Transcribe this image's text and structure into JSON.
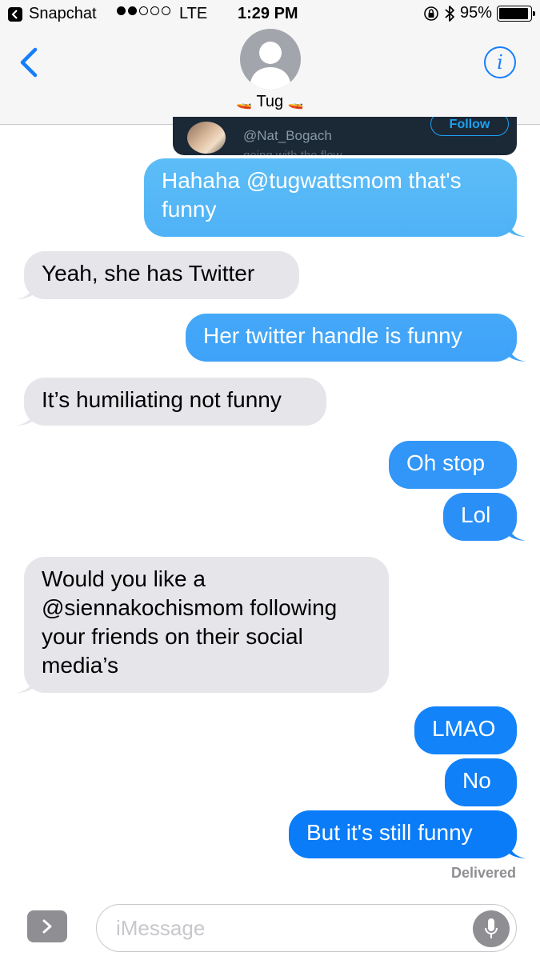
{
  "status_bar": {
    "app_back_label": "Snapchat",
    "signal_full_dots": 2,
    "signal_total_dots": 5,
    "carrier": "LTE",
    "time": "1:29 PM",
    "battery_percent": "95%",
    "battery_level": 0.95,
    "icons": [
      "orientation-lock-icon",
      "bluetooth-icon",
      "battery-icon"
    ]
  },
  "header": {
    "back_icon": "chevron-left-icon",
    "contact_name": "Tug",
    "name_emoji": "🚤",
    "info_icon": "info-icon",
    "info_label": "i",
    "accent_color": "#157efb"
  },
  "tweet_card": {
    "handle": "@Nat_Bogach",
    "follow_label": "Follow",
    "bio_fragment": "going with the flow"
  },
  "messages": [
    {
      "side": "outgoing",
      "text": "Hahaha @tugwattsmom that's funny"
    },
    {
      "side": "incoming",
      "text": "Yeah, she has Twitter"
    },
    {
      "side": "outgoing",
      "text": "Her twitter handle is funny"
    },
    {
      "side": "incoming",
      "text": "It’s humiliating not funny"
    },
    {
      "side": "outgoing",
      "text": "Oh stop"
    },
    {
      "side": "outgoing",
      "text": "Lol"
    },
    {
      "side": "incoming",
      "text": "Would you like a @siennakochismom following your friends on their social media’s"
    },
    {
      "side": "outgoing",
      "text": "LMAO"
    },
    {
      "side": "outgoing",
      "text": "No"
    },
    {
      "side": "outgoing",
      "text": "But it's still funny"
    }
  ],
  "delivered_label": "Delivered",
  "input": {
    "placeholder": "iMessage",
    "apps_icon": "chevron-right-icon",
    "mic_icon": "microphone-icon"
  },
  "colors": {
    "outgoing_gradient_top": "#5ac8fa",
    "outgoing_gradient_bottom": "#007aff",
    "incoming_bubble": "#e5e5ea"
  }
}
